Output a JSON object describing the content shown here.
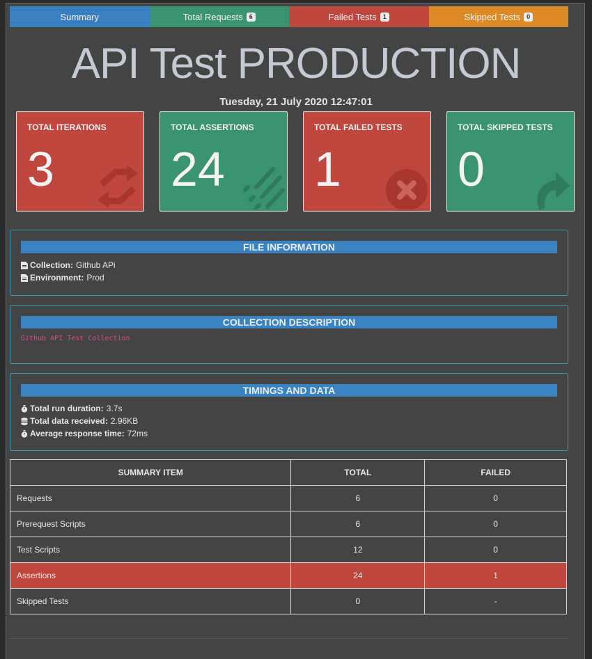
{
  "tabs": [
    {
      "label": "Summary",
      "badge": null,
      "color": "#3a7fc0"
    },
    {
      "label": "Total Requests",
      "badge": "6",
      "color": "#3a9472"
    },
    {
      "label": "Failed Tests",
      "badge": "1",
      "color": "#c0473d"
    },
    {
      "label": "Skipped Tests",
      "badge": "0",
      "color": "#dc8a25"
    }
  ],
  "header": {
    "title": "API Test PRODUCTION",
    "date": "Tuesday, 21 July 2020 12:47:01"
  },
  "cards": [
    {
      "label": "TOTAL ITERATIONS",
      "value": "3",
      "icon": "sync-icon",
      "color": "#c0473d"
    },
    {
      "label": "TOTAL ASSERTIONS",
      "value": "24",
      "icon": "list-check-icon",
      "color": "#3a9472"
    },
    {
      "label": "TOTAL FAILED TESTS",
      "value": "1",
      "icon": "times-circle-icon",
      "color": "#c0473d"
    },
    {
      "label": "TOTAL SKIPPED TESTS",
      "value": "0",
      "icon": "share-arrow-icon",
      "color": "#3a9472"
    }
  ],
  "file_info": {
    "heading": "FILE INFORMATION",
    "collection_label": "Collection:",
    "collection_value": "Github APi",
    "environment_label": "Environment:",
    "environment_value": "Prod"
  },
  "collection_description": {
    "heading": "COLLECTION DESCRIPTION",
    "text": "Github API Test Collection"
  },
  "timings": {
    "heading": "TIMINGS AND DATA",
    "run_duration_label": "Total run duration:",
    "run_duration_value": "3.7s",
    "data_received_label": "Total data received:",
    "data_received_value": "2.96KB",
    "avg_response_label": "Average response time:",
    "avg_response_value": "72ms"
  },
  "summary_table": {
    "headers": [
      "SUMMARY ITEM",
      "TOTAL",
      "FAILED"
    ],
    "rows": [
      {
        "item": "Requests",
        "total": "6",
        "failed": "0"
      },
      {
        "item": "Prerequest Scripts",
        "total": "6",
        "failed": "0"
      },
      {
        "item": "Test Scripts",
        "total": "12",
        "failed": "0"
      },
      {
        "item": "Assertions",
        "total": "24",
        "failed": "1"
      },
      {
        "item": "Skipped Tests",
        "total": "0",
        "failed": "-"
      }
    ]
  }
}
